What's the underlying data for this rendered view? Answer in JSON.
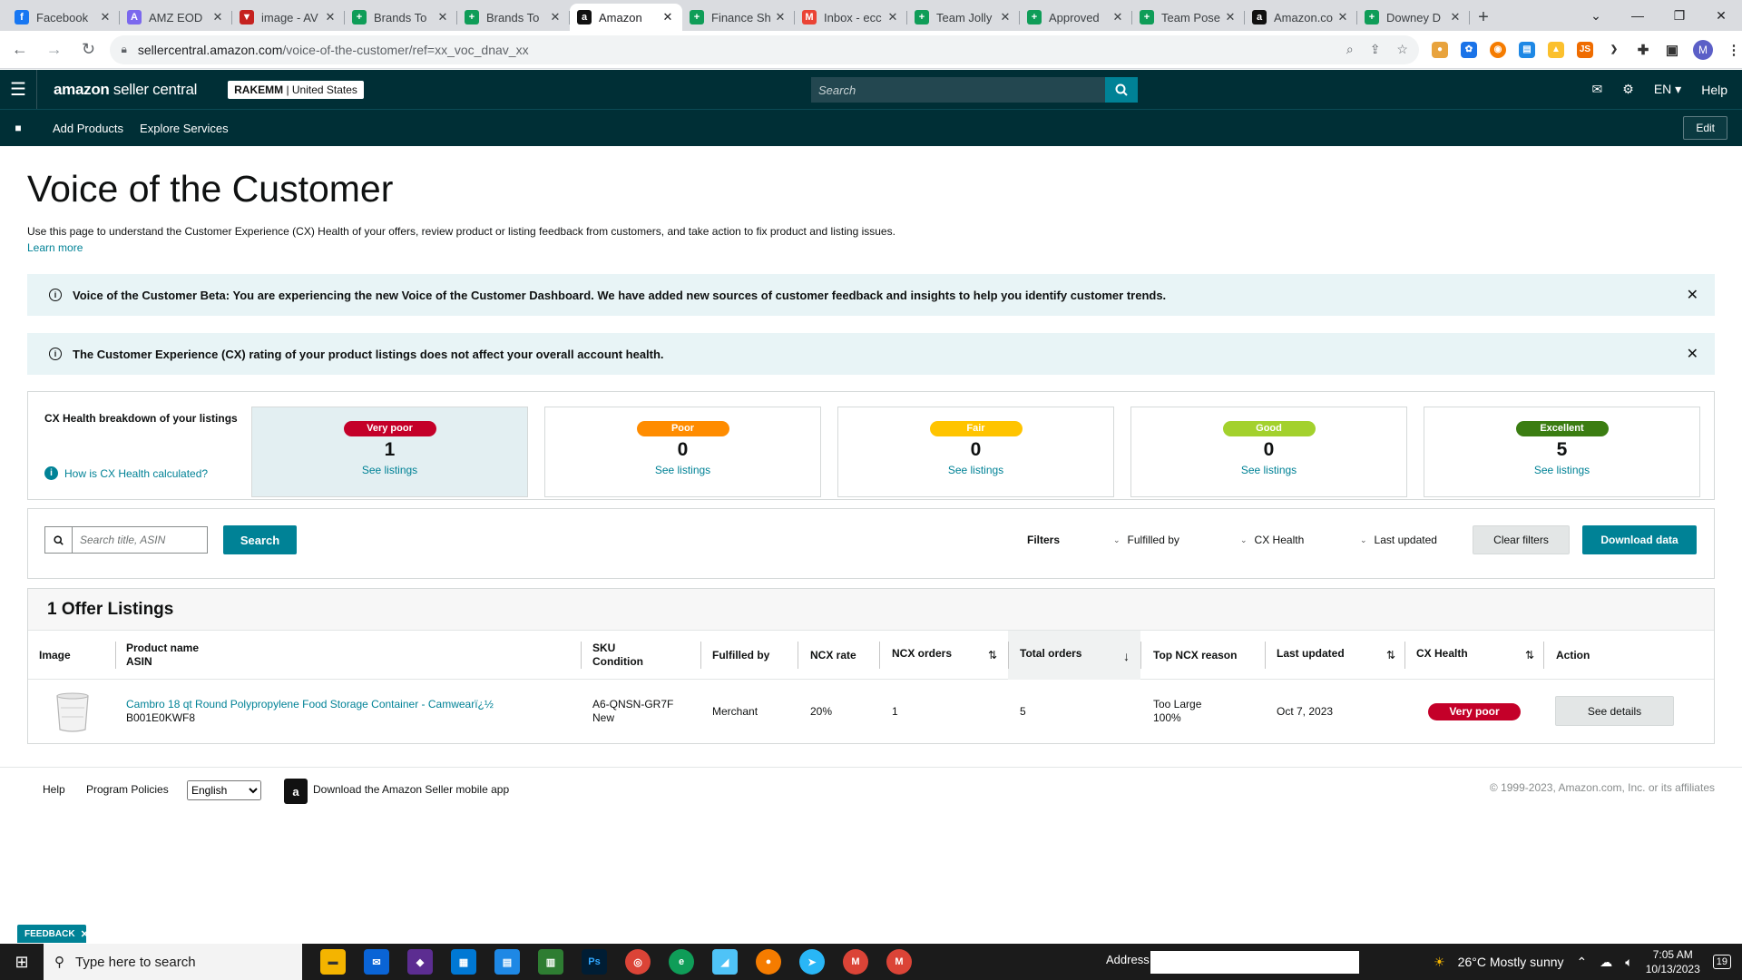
{
  "browser": {
    "tabs": [
      {
        "title": "Facebook",
        "icon": "facebook-icon",
        "color": "#1877f2",
        "glyph": "f"
      },
      {
        "title": "AMZ EOD",
        "icon": "clickup-icon",
        "color": "#7b68ee",
        "glyph": "A"
      },
      {
        "title": "image - AV",
        "icon": "gmail-icon",
        "color": "#c5221f",
        "glyph": "▼"
      },
      {
        "title": "Brands To",
        "icon": "sheets-icon",
        "color": "#0f9d58",
        "glyph": "+"
      },
      {
        "title": "Brands To",
        "icon": "sheets-icon",
        "color": "#0f9d58",
        "glyph": "+"
      },
      {
        "title": "Amazon",
        "icon": "amazon-icon",
        "color": "#111111",
        "glyph": "a"
      },
      {
        "title": "Finance Sh",
        "icon": "sheets-icon",
        "color": "#0f9d58",
        "glyph": "+"
      },
      {
        "title": "Inbox - ecc",
        "icon": "gmail-icon",
        "color": "#ea4335",
        "glyph": "M"
      },
      {
        "title": "Team Jolly",
        "icon": "sheets-icon",
        "color": "#0f9d58",
        "glyph": "+"
      },
      {
        "title": "Approved",
        "icon": "sheets-icon",
        "color": "#0f9d58",
        "glyph": "+"
      },
      {
        "title": "Team Pose",
        "icon": "sheets-icon",
        "color": "#0f9d58",
        "glyph": "+"
      },
      {
        "title": "Amazon.co",
        "icon": "amazon-icon",
        "color": "#111111",
        "glyph": "a"
      },
      {
        "title": "Downey D",
        "icon": "sheets-icon",
        "color": "#0f9d58",
        "glyph": "+"
      }
    ],
    "active_tab": 5,
    "url_host": "sellercentral.amazon.com",
    "url_path": "/voice-of-the-customer/ref=xx_voc_dnav_xx",
    "profile_initial": "M"
  },
  "header": {
    "logo_main": "amazon",
    "logo_sub": " seller central",
    "account_name": "RAKEMM",
    "account_region": " | United States",
    "search_placeholder": "Search",
    "language": "EN ▾",
    "help": "Help"
  },
  "subnav": {
    "add_products": "Add Products",
    "explore_services": "Explore Services",
    "edit": "Edit"
  },
  "page": {
    "title": "Voice of the Customer",
    "description": "Use this page to understand the Customer Experience (CX) Health of your offers, review product or listing feedback from customers, and take action to fix product and listing issues.",
    "learn_more": "Learn more",
    "banner_beta": "Voice of the Customer Beta: You are experiencing the new Voice of the Customer Dashboard. We have added new sources of customer feedback and insights to help you identify customer trends.",
    "banner_cx": "The Customer Experience (CX) rating of your product listings does not affect your overall account health."
  },
  "cx_health": {
    "label": "CX Health breakdown of your listings",
    "how_link": "How is CX Health calculated?",
    "see_listings": "See listings",
    "cards": [
      {
        "label": "Very poor",
        "count": "1",
        "color": "#c40029"
      },
      {
        "label": "Poor",
        "count": "0",
        "color": "#ff8c00"
      },
      {
        "label": "Fair",
        "count": "0",
        "color": "#ffc400"
      },
      {
        "label": "Good",
        "count": "0",
        "color": "#a3d12d"
      },
      {
        "label": "Excellent",
        "count": "5",
        "color": "#3b7d12"
      }
    ]
  },
  "filters": {
    "search_placeholder": "Search title, ASIN",
    "search_button": "Search",
    "filters_label": "Filters",
    "fulfilled_by": "Fulfilled by",
    "cx_health": "CX Health",
    "last_updated": "Last updated",
    "clear_filters": "Clear filters",
    "download_data": "Download data"
  },
  "table": {
    "title": "1 Offer Listings",
    "headers": {
      "image": "Image",
      "product_name": "Product name",
      "asin": "ASIN",
      "sku": "SKU",
      "condition": "Condition",
      "fulfilled_by": "Fulfilled by",
      "ncx_rate": "NCX rate",
      "ncx_orders": "NCX orders",
      "total_orders": "Total orders",
      "top_ncx_reason": "Top NCX reason",
      "last_updated": "Last updated",
      "cx_health": "CX Health",
      "action": "Action"
    },
    "rows": [
      {
        "product_name": "Cambro 18 qt Round Polypropylene Food Storage Container - Camwearï¿½",
        "asin": "B001E0KWF8",
        "sku": "A6-QNSN-GR7F",
        "condition": "New",
        "fulfilled_by": "Merchant",
        "ncx_rate": "20%",
        "ncx_orders": "1",
        "total_orders": "5",
        "top_ncx_reason": "Too Large",
        "top_ncx_pct": "100%",
        "last_updated": "Oct 7, 2023",
        "cx_health": "Very poor",
        "action": "See details"
      }
    ]
  },
  "footer": {
    "help": "Help",
    "program_policies": "Program Policies",
    "language": "English",
    "app_download": "Download the Amazon Seller mobile app",
    "copyright": "© 1999-2023, Amazon.com, Inc. or its affiliates"
  },
  "feedback": "FEEDBACK",
  "taskbar": {
    "search_placeholder": "Type here to search",
    "address_label": "Address",
    "weather": "26°C  Mostly sunny",
    "time": "7:05 AM",
    "date": "10/13/2023",
    "notifications": "19"
  }
}
